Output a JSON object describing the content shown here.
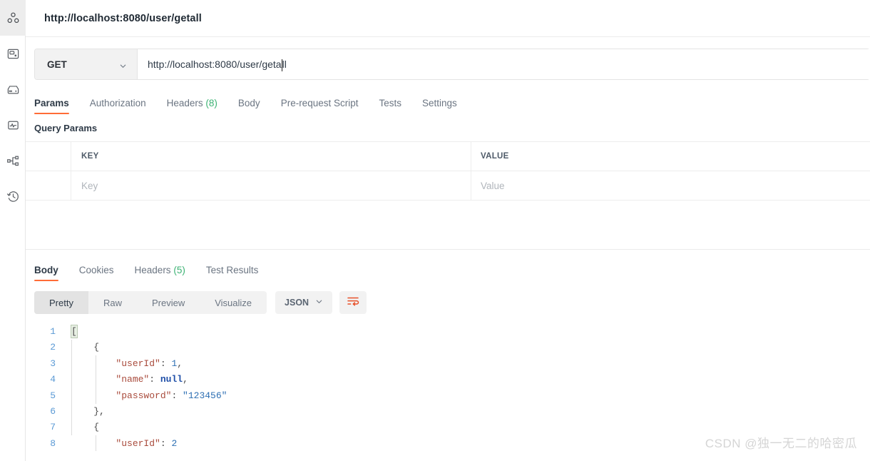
{
  "sidebar": {
    "items": [
      {
        "name": "collections-icon",
        "label": "Collections",
        "active": true
      },
      {
        "name": "apis-icon",
        "label": "APIs",
        "active": false
      },
      {
        "name": "environments-icon",
        "label": "Environments",
        "active": false
      },
      {
        "name": "monitors-icon",
        "label": "Monitors",
        "active": false
      },
      {
        "name": "flows-icon",
        "label": "Flows",
        "active": false
      },
      {
        "name": "history-icon",
        "label": "History",
        "active": false
      }
    ]
  },
  "header": {
    "title": "http://localhost:8080/user/getall"
  },
  "request": {
    "method": "GET",
    "url_before_caret": "http://localhost:8080/user/geta",
    "url_after_caret": "ll",
    "url_full": "http://localhost:8080/user/getall",
    "tabs": [
      {
        "label": "Params",
        "count": "",
        "active": true
      },
      {
        "label": "Authorization",
        "count": "",
        "active": false
      },
      {
        "label": "Headers",
        "count": "(8)",
        "active": false
      },
      {
        "label": "Body",
        "count": "",
        "active": false
      },
      {
        "label": "Pre-request Script",
        "count": "",
        "active": false
      },
      {
        "label": "Tests",
        "count": "",
        "active": false
      },
      {
        "label": "Settings",
        "count": "",
        "active": false
      }
    ],
    "params_section_title": "Query Params",
    "params_table": {
      "headers": [
        "KEY",
        "VALUE"
      ],
      "rows": [
        {
          "key_placeholder": "Key",
          "value_placeholder": "Value"
        }
      ]
    }
  },
  "response": {
    "tabs": [
      {
        "label": "Body",
        "count": "",
        "active": true
      },
      {
        "label": "Cookies",
        "count": "",
        "active": false
      },
      {
        "label": "Headers",
        "count": "(5)",
        "active": false
      },
      {
        "label": "Test Results",
        "count": "",
        "active": false
      }
    ],
    "view_modes": [
      {
        "label": "Pretty",
        "active": true
      },
      {
        "label": "Raw",
        "active": false
      },
      {
        "label": "Preview",
        "active": false
      },
      {
        "label": "Visualize",
        "active": false
      }
    ],
    "format": "JSON",
    "wrap_icon": "wrap-text-icon",
    "body_lines": [
      {
        "num": "1",
        "text": "["
      },
      {
        "num": "2",
        "text": "    {"
      },
      {
        "num": "3",
        "text": "        \"userId\": 1,"
      },
      {
        "num": "4",
        "text": "        \"name\": null,"
      },
      {
        "num": "5",
        "text": "        \"password\": \"123456\""
      },
      {
        "num": "6",
        "text": "    },"
      },
      {
        "num": "7",
        "text": "    {"
      },
      {
        "num": "8",
        "text": "        \"userId\": 2"
      }
    ]
  },
  "watermark": {
    "text": "CSDN @独一无二的哈密瓜"
  },
  "colors": {
    "accent": "#ff6c37",
    "count_green": "#3bb273",
    "json_key": "#a94b3c",
    "json_string": "#2d6fb3",
    "json_number": "#2d6fb3",
    "json_null": "#1f4fa8",
    "gutter": "#5b9ad5"
  }
}
